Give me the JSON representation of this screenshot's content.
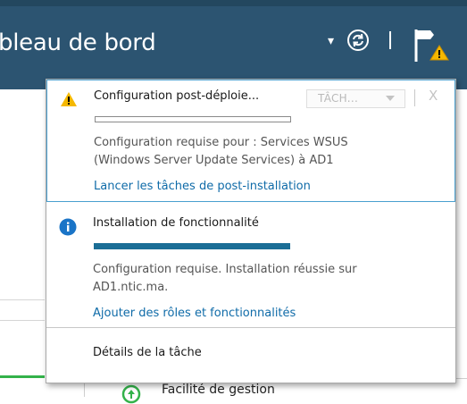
{
  "header": {
    "title": "bleau de bord",
    "dropdown_glyph": "▾",
    "refresh_icon": "refresh-icon",
    "flag_icon": "notification-flag-warning-icon"
  },
  "background": {
    "bottom_item": "Facilité de gestion"
  },
  "notifications": {
    "items": [
      {
        "icon": "warning-icon",
        "title": "Configuration post-déploie...",
        "task_dropdown": "TÂCH...",
        "close": "X",
        "progress": 0.0,
        "desc_line1": "Configuration requise pour : Services WSUS",
        "desc_line2": "(Windows Server Update Services) à AD1",
        "link": "Lancer les tâches de post-installation"
      },
      {
        "icon": "info-icon",
        "title": "Installation de fonctionnalité",
        "progress": 1.0,
        "desc_line1": "Configuration requise. Installation réussie sur",
        "desc_line2": "AD1.ntic.ma.",
        "link": "Ajouter des rôles et fonctionnalités"
      }
    ],
    "task_details": "Détails de la tâche"
  },
  "colors": {
    "header_bg": "#2c5471",
    "accent_blue": "#1b6e96",
    "link": "#0f6ba8",
    "warning": "#f5b800",
    "info": "#1a74c7",
    "green_indicator": "#33b24a"
  }
}
